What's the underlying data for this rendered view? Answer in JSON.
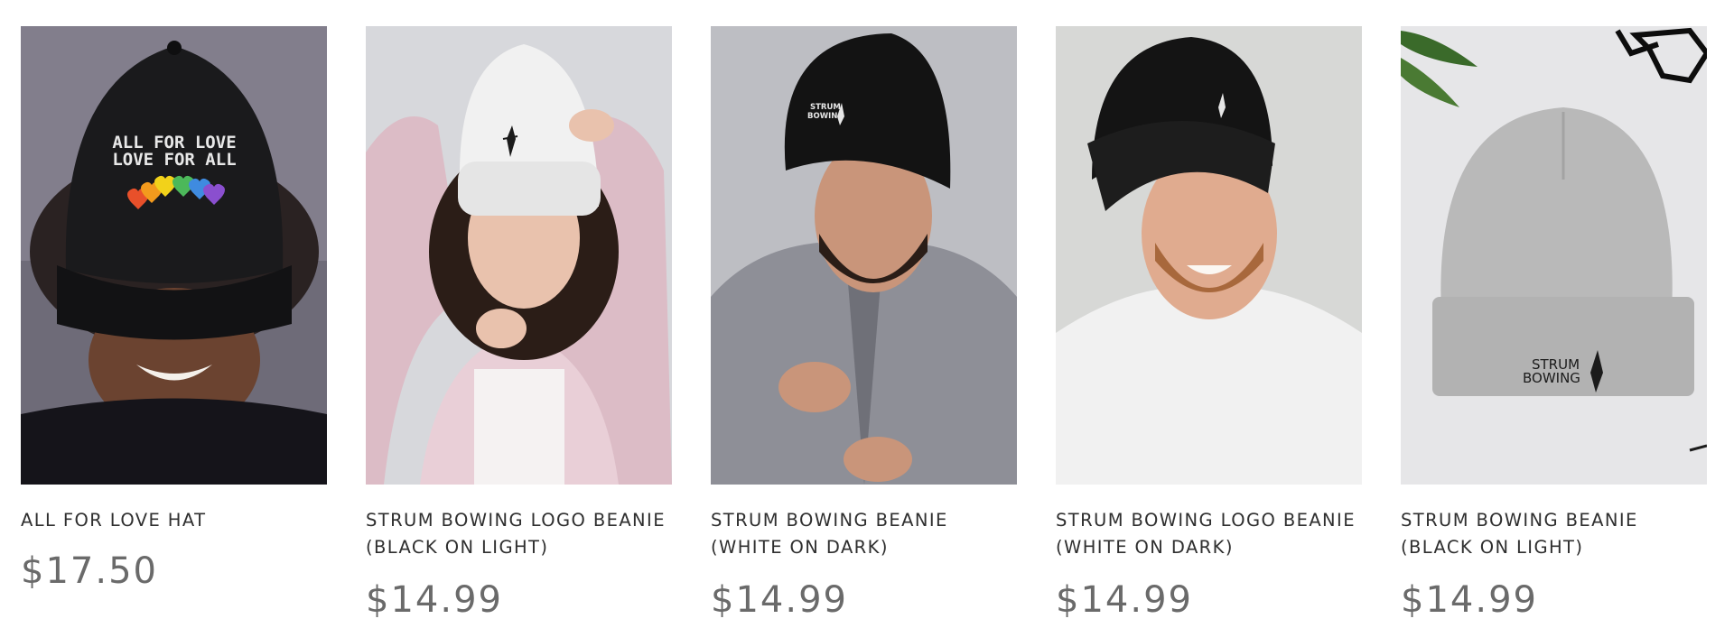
{
  "products": [
    {
      "title": "ALL FOR LOVE HAT",
      "price": "$17.50",
      "image": {
        "hat_text_line1": "ALL FOR LOVE",
        "hat_text_line2": "LOVE FOR ALL"
      }
    },
    {
      "title": "STRUM BOWING LOGO BEANIE\n(BLACK ON LIGHT)",
      "price": "$14.99"
    },
    {
      "title": "STRUM BOWING BEANIE\n(WHITE ON DARK)",
      "price": "$14.99",
      "image": {
        "logo_line1": "STRUM",
        "logo_line2": "BOWING"
      }
    },
    {
      "title": "STRUM BOWING LOGO BEANIE\n(WHITE ON DARK)",
      "price": "$14.99"
    },
    {
      "title": "STRUM BOWING BEANIE\n(BLACK ON LIGHT)",
      "price": "$14.99",
      "image": {
        "logo_line1": "STRUM",
        "logo_line2": "BOWING"
      }
    }
  ],
  "colors": {
    "title_text": "#2f2f2f",
    "price_text": "#6a6a6a",
    "heart_colors": [
      "#e8502a",
      "#f39a1d",
      "#f2d21a",
      "#4cb85a",
      "#3f8be0",
      "#8a4fcf"
    ]
  }
}
